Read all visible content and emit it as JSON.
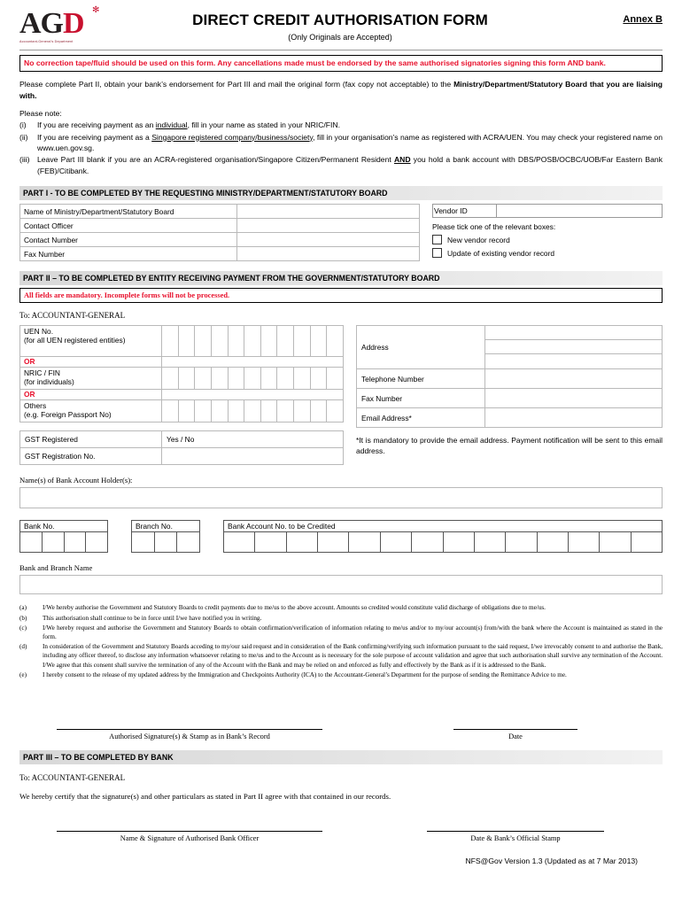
{
  "header": {
    "logo_text": "AGD",
    "logo_tagline": "Accountant-General's Department",
    "title": "DIRECT CREDIT AUTHORISATION FORM",
    "subtitle": "(Only Originals are Accepted)",
    "annex": "Annex B"
  },
  "warning": "No correction tape/fluid should be used on this form.  Any cancellations made must be endorsed by the same authorised signatories signing this form AND bank.",
  "intro": {
    "line_prefix": "Please complete Part II, obtain your bank’s endorsement for Part III and mail the original form (fax copy not acceptable) to the ",
    "line_bold": "Ministry/Department/Statutory Board that you are liaising with.",
    "note_heading": "Please note:"
  },
  "notes": [
    {
      "num": "(i)",
      "pre": "If you are receiving payment as an ",
      "underline": "individual",
      "post": ", fill in your name as stated in your NRIC/FIN."
    },
    {
      "num": "(ii)",
      "pre": "If you are receiving payment as a ",
      "underline": "Singapore registered company/business/society",
      "post": ", fill in your organisation’s name as registered with ACRA/UEN. You may check your registered name on www.uen.gov.sg."
    },
    {
      "num": "(iii)",
      "pre": "Leave Part III blank if you are an ACRA-registered organisation/Singapore Citizen/Permanent Resident ",
      "bold_underline": "AND",
      "post": " you hold a bank account with DBS/POSB/OCBC/UOB/Far Eastern Bank (FEB)/Citibank."
    }
  ],
  "part1": {
    "bar": "PART I - TO BE COMPLETED BY THE REQUESTING MINISTRY/DEPARTMENT/STATUTORY BOARD",
    "fields": [
      "Name of Ministry/Department/Statutory Board",
      "Contact Officer",
      "Contact Number",
      "Fax Number"
    ],
    "vendor_id_label": "Vendor ID",
    "vendor_id_value": "",
    "tick_instruction": "Please tick one of the relevant boxes:",
    "checkboxes": [
      "New vendor record",
      "Update of existing vendor record"
    ]
  },
  "part2": {
    "bar": "PART II – TO BE COMPLETED BY ENTITY RECEIVING PAYMENT FROM THE GOVERNMENT/STATUTORY BOARD",
    "mandatory_notice": "All fields are mandatory. Incomplete forms will not be processed.",
    "to": "To: ACCOUNTANT-GENERAL",
    "id_rows": [
      {
        "label": "UEN No.",
        "sub": "(for all UEN registered entities)",
        "boxes": 11
      },
      {
        "label": "NRIC / FIN",
        "sub": "(for individuals)",
        "boxes": 11
      },
      {
        "label": "Others",
        "sub": "(e.g. Foreign Passport No)",
        "boxes": 11
      }
    ],
    "or_text": "OR",
    "gst": [
      {
        "label": "GST Registered",
        "value": "Yes / No"
      },
      {
        "label": "GST Registration No.",
        "value": ""
      }
    ],
    "contact": {
      "address_label": "Address",
      "address_lines": 3,
      "telephone_label": "Telephone Number",
      "fax_label": "Fax Number",
      "email_label": "Email Address*"
    },
    "email_note": "*It is mandatory to provide the email address. Payment notification will be sent to this email address.",
    "holder_label": "Name(s) of Bank Account Holder(s):",
    "bank_no_label": "Bank No.",
    "bank_no_boxes": 4,
    "branch_no_label": "Branch No.",
    "branch_no_boxes": 3,
    "account_no_label": "Bank Account No. to be Credited",
    "account_no_boxes": 14,
    "bank_branch_name_label": "Bank and Branch Name"
  },
  "clauses": [
    {
      "num": "(a)",
      "text": "I/We hereby authorise the Government and Statutory Boards to credit payments due to me/us to the above account.  Amounts so credited would constitute valid discharge of obligations due to me/us."
    },
    {
      "num": "(b)",
      "text": "This authorisation shall continue to be in force until I/we have notified you in writing."
    },
    {
      "num": "(c)",
      "text": "I/We hereby request and authorise the Government and Statutory Boards to obtain confirmation/verification of information relating to me/us and/or to my/our account(s) from/with the bank where the Account is maintained as stated in the form."
    },
    {
      "num": "(d)",
      "text": "In consideration of the Government and Statutory Boards acceding to my/our said request and in consideration of the Bank confirming/verifying such information pursuant to the said request, I/we irrevocably consent to and authorise the Bank, including any officer thereof, to disclose any information whatsoever relating to me/us and to the Account as is necessary for the sole purpose of account validation and agree that such authorisation shall survive any termination of the Account. I/We agree that this consent shall survive the termination of any of the Account with the Bank and may be relied on and enforced as fully and effectively by the Bank as if it is addressed to the Bank."
    },
    {
      "num": "(e)",
      "text": "I hereby consent to the release of my updated address by the Immigration and Checkpoints Authority (ICA) to the Accountant-General’s Department for the purpose of sending the Remittance Advice to me."
    }
  ],
  "signatures_part2": {
    "left_caption": "Authorised Signature(s) & Stamp as in Bank’s Record",
    "right_caption": "Date"
  },
  "part3": {
    "bar": "PART III – TO BE COMPLETED BY BANK",
    "to": "To:  ACCOUNTANT-GENERAL",
    "certify": "We hereby certify that the signature(s) and other particulars as stated in Part II agree with that contained in our records.",
    "left_caption": "Name & Signature of Authorised Bank Officer",
    "right_caption": "Date & Bank’s Official Stamp"
  },
  "footer": {
    "version": "NFS@Gov Version 1.3 (Updated as at 7 Mar 2013)"
  },
  "colors": {
    "red": "#e8112d",
    "logo_red": "#c8102e",
    "bar": "#dcdcdc"
  }
}
